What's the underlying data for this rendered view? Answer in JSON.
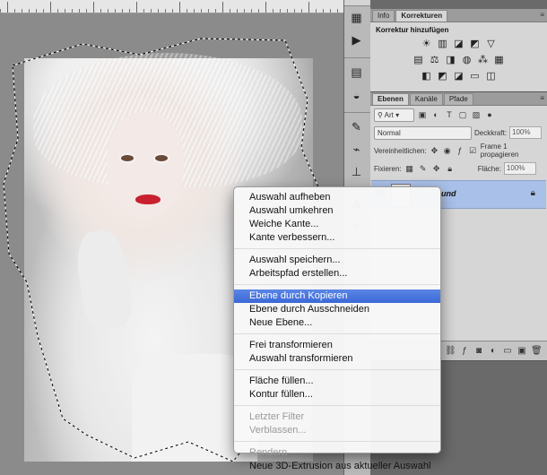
{
  "panels": {
    "top_tabs": [
      "Info",
      "Korrekturen"
    ],
    "adjustments_title": "Korrektur hinzufügen",
    "adjustment_icons_row1": [
      "brightness-icon",
      "levels-icon",
      "curves-icon",
      "exposure-icon",
      "vibrance-icon"
    ],
    "adjustment_icons_row2": [
      "hue-saturation-icon",
      "color-balance-icon",
      "black-white-icon",
      "photo-filter-icon",
      "channel-mixer-icon",
      "color-lookup-icon"
    ],
    "adjustment_icons_row3": [
      "invert-icon",
      "posterize-icon",
      "threshold-icon",
      "gradient-map-icon",
      "selective-color-icon"
    ],
    "layer_tabs": [
      "Ebenen",
      "Kanäle",
      "Pfade"
    ],
    "filter_kind": "Art",
    "blend_mode": "Normal",
    "opacity_label": "Deckkraft:",
    "opacity_value": "100%",
    "unify_label": "Vereinheitlichen:",
    "propagate_label": "Frame 1 propagieren",
    "lock_label": "Fixieren:",
    "fill_label": "Fläche:",
    "fill_value": "100%",
    "layer_name": "und"
  },
  "context_menu": {
    "groups": [
      [
        {
          "label": "Auswahl aufheben",
          "state": "normal"
        },
        {
          "label": "Auswahl umkehren",
          "state": "normal"
        },
        {
          "label": "Weiche Kante...",
          "state": "normal"
        },
        {
          "label": "Kante verbessern...",
          "state": "normal"
        }
      ],
      [
        {
          "label": "Auswahl speichern...",
          "state": "normal"
        },
        {
          "label": "Arbeitspfad erstellen...",
          "state": "normal"
        }
      ],
      [
        {
          "label": "Ebene durch Kopieren",
          "state": "highlighted"
        },
        {
          "label": "Ebene durch Ausschneiden",
          "state": "normal"
        },
        {
          "label": "Neue Ebene...",
          "state": "normal"
        }
      ],
      [
        {
          "label": "Frei transformieren",
          "state": "normal"
        },
        {
          "label": "Auswahl transformieren",
          "state": "normal"
        }
      ],
      [
        {
          "label": "Fläche füllen...",
          "state": "normal"
        },
        {
          "label": "Kontur füllen...",
          "state": "normal"
        }
      ],
      [
        {
          "label": "Letzter Filter",
          "state": "disabled"
        },
        {
          "label": "Verblassen...",
          "state": "disabled"
        }
      ],
      [
        {
          "label": "Rendern",
          "state": "disabled"
        },
        {
          "label": "Neue 3D-Extrusion aus aktueller Auswahl",
          "state": "normal"
        }
      ]
    ]
  },
  "colors": {
    "highlight": "#3a68d6",
    "layer_selected": "#a9c0e8",
    "workspace": "#8b8b8b"
  }
}
